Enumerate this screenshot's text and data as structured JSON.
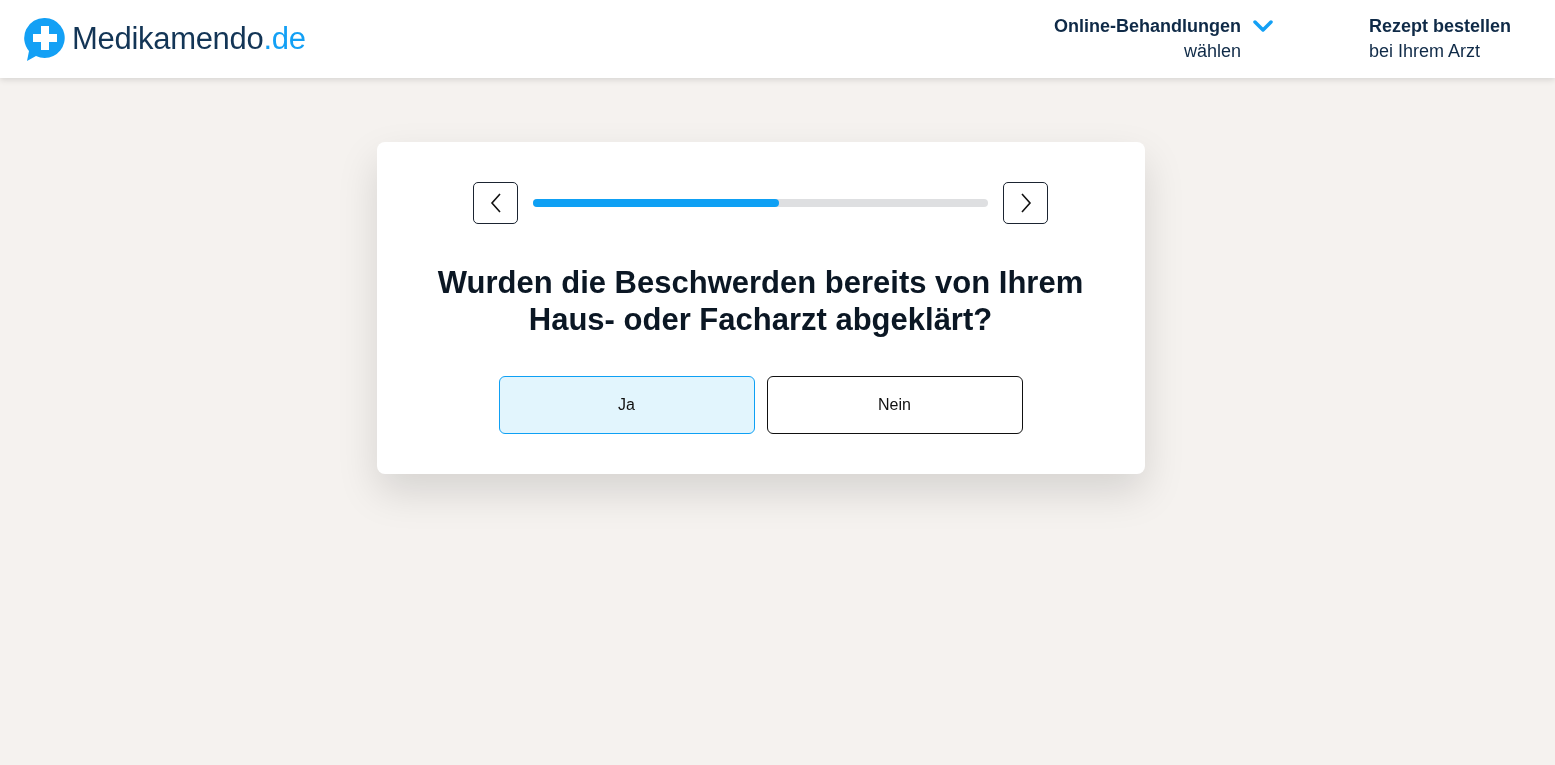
{
  "header": {
    "brand": {
      "name": "Medikamendo",
      "suffix": ".de"
    },
    "nav": [
      {
        "kind": "dropdown",
        "title": "Online-Behandlungen",
        "subtitle": "wählen"
      },
      {
        "kind": "link",
        "title": "Rezept bestellen",
        "subtitle": "bei Ihrem Arzt"
      }
    ]
  },
  "quiz": {
    "progress": {
      "level": 0.54
    },
    "question": "Wurden die Beschwerden bereits von Ihrem Haus- oder Facharzt abgeklärt?",
    "answers": [
      {
        "label": "Ja",
        "selected": true
      },
      {
        "label": "Nein",
        "selected": false
      }
    ]
  }
}
